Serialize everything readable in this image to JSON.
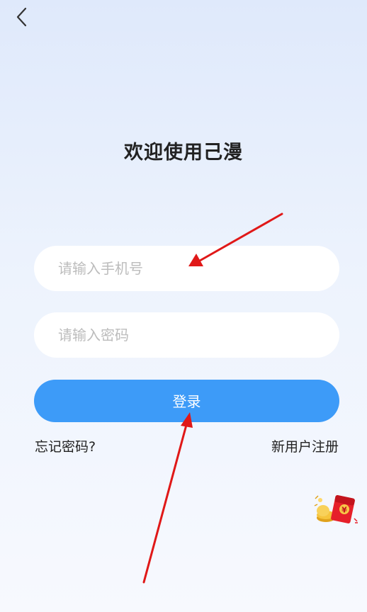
{
  "header": {
    "back_icon": "chevron-left-icon"
  },
  "main": {
    "title": "欢迎使用己漫",
    "phone_placeholder": "请输入手机号",
    "password_placeholder": "请输入密码",
    "login_label": "登录",
    "forgot_label": "忘记密码?",
    "register_label": "新用户注册"
  },
  "floating": {
    "red_packet_icon": "red-envelope-icon",
    "red_packet_symbol": "¥"
  },
  "colors": {
    "accent": "#3d9bf8",
    "annotation_arrow": "#e01818"
  }
}
